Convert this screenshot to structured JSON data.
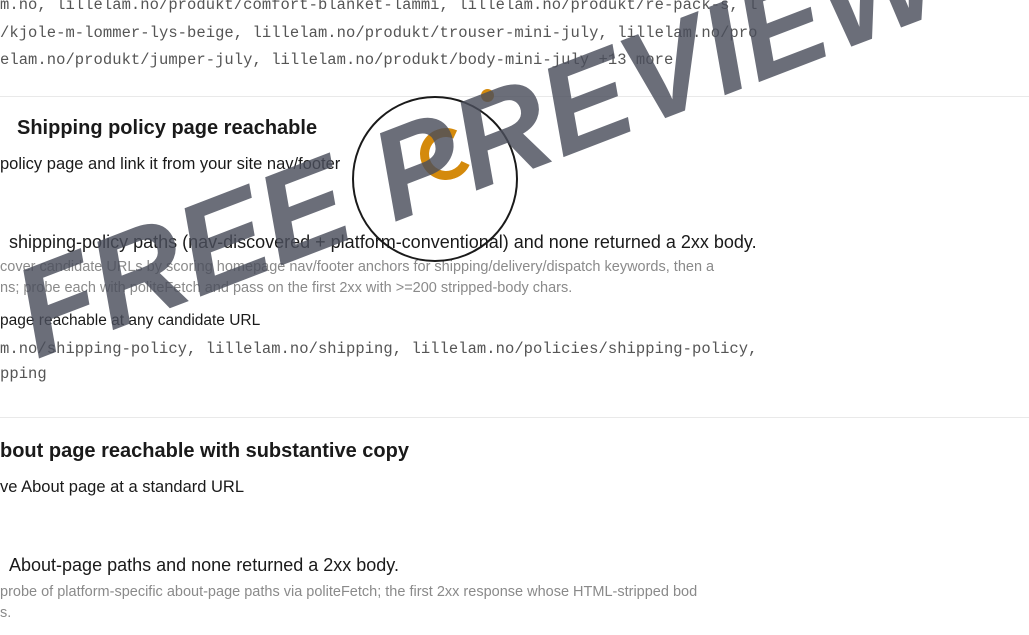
{
  "top_urls": {
    "line1": "m.no, lillelam.no/produkt/comfort-blanket-lammi, lillelam.no/produkt/re-pack-s, l",
    "line2": "/kjole-m-lommer-lys-beige, lillelam.no/produkt/trouser-mini-july, lillelam.no/pro",
    "line3": "elam.no/produkt/jumper-july, lillelam.no/produkt/body-mini-july +13 more"
  },
  "shipping_check": {
    "title": "Shipping policy page reachable",
    "subtitle_part1": "policy page and link it from your site",
    "subtitle_part2": "nav/footer",
    "result": "shipping-policy paths (nav-discovered + platform-conventional) and none returned a 2xx body.",
    "method_line1": "cover candidate URLs by scoring homepage nav/footer anchors for shipping/delivery/dispatch keywords, then a",
    "method_line2": "ns; probe each with politeFetch and pass on the first 2xx with >=200 stripped-body chars.",
    "missing": "page reachable at any candidate URL",
    "urls_line1": "m.no/shipping-policy, lillelam.no/shipping, lillelam.no/policies/shipping-policy,",
    "urls_line2": "pping"
  },
  "about_check": {
    "title": "bout page reachable with substantive copy",
    "subtitle": "ve About page at a standard URL",
    "result": "About-page paths and none returned a 2xx body.",
    "method_line1": "probe of platform-specific about-page paths via politeFetch; the first 2xx response whose HTML-stripped bod",
    "method_line2": "s."
  },
  "logo": {
    "icon": "brand-c-logo",
    "ring_color": "#1a1a1a",
    "accent_color": "#d48a0c"
  },
  "watermark": {
    "text": "FREE PREVIEW",
    "color": "#4b4e5c"
  }
}
